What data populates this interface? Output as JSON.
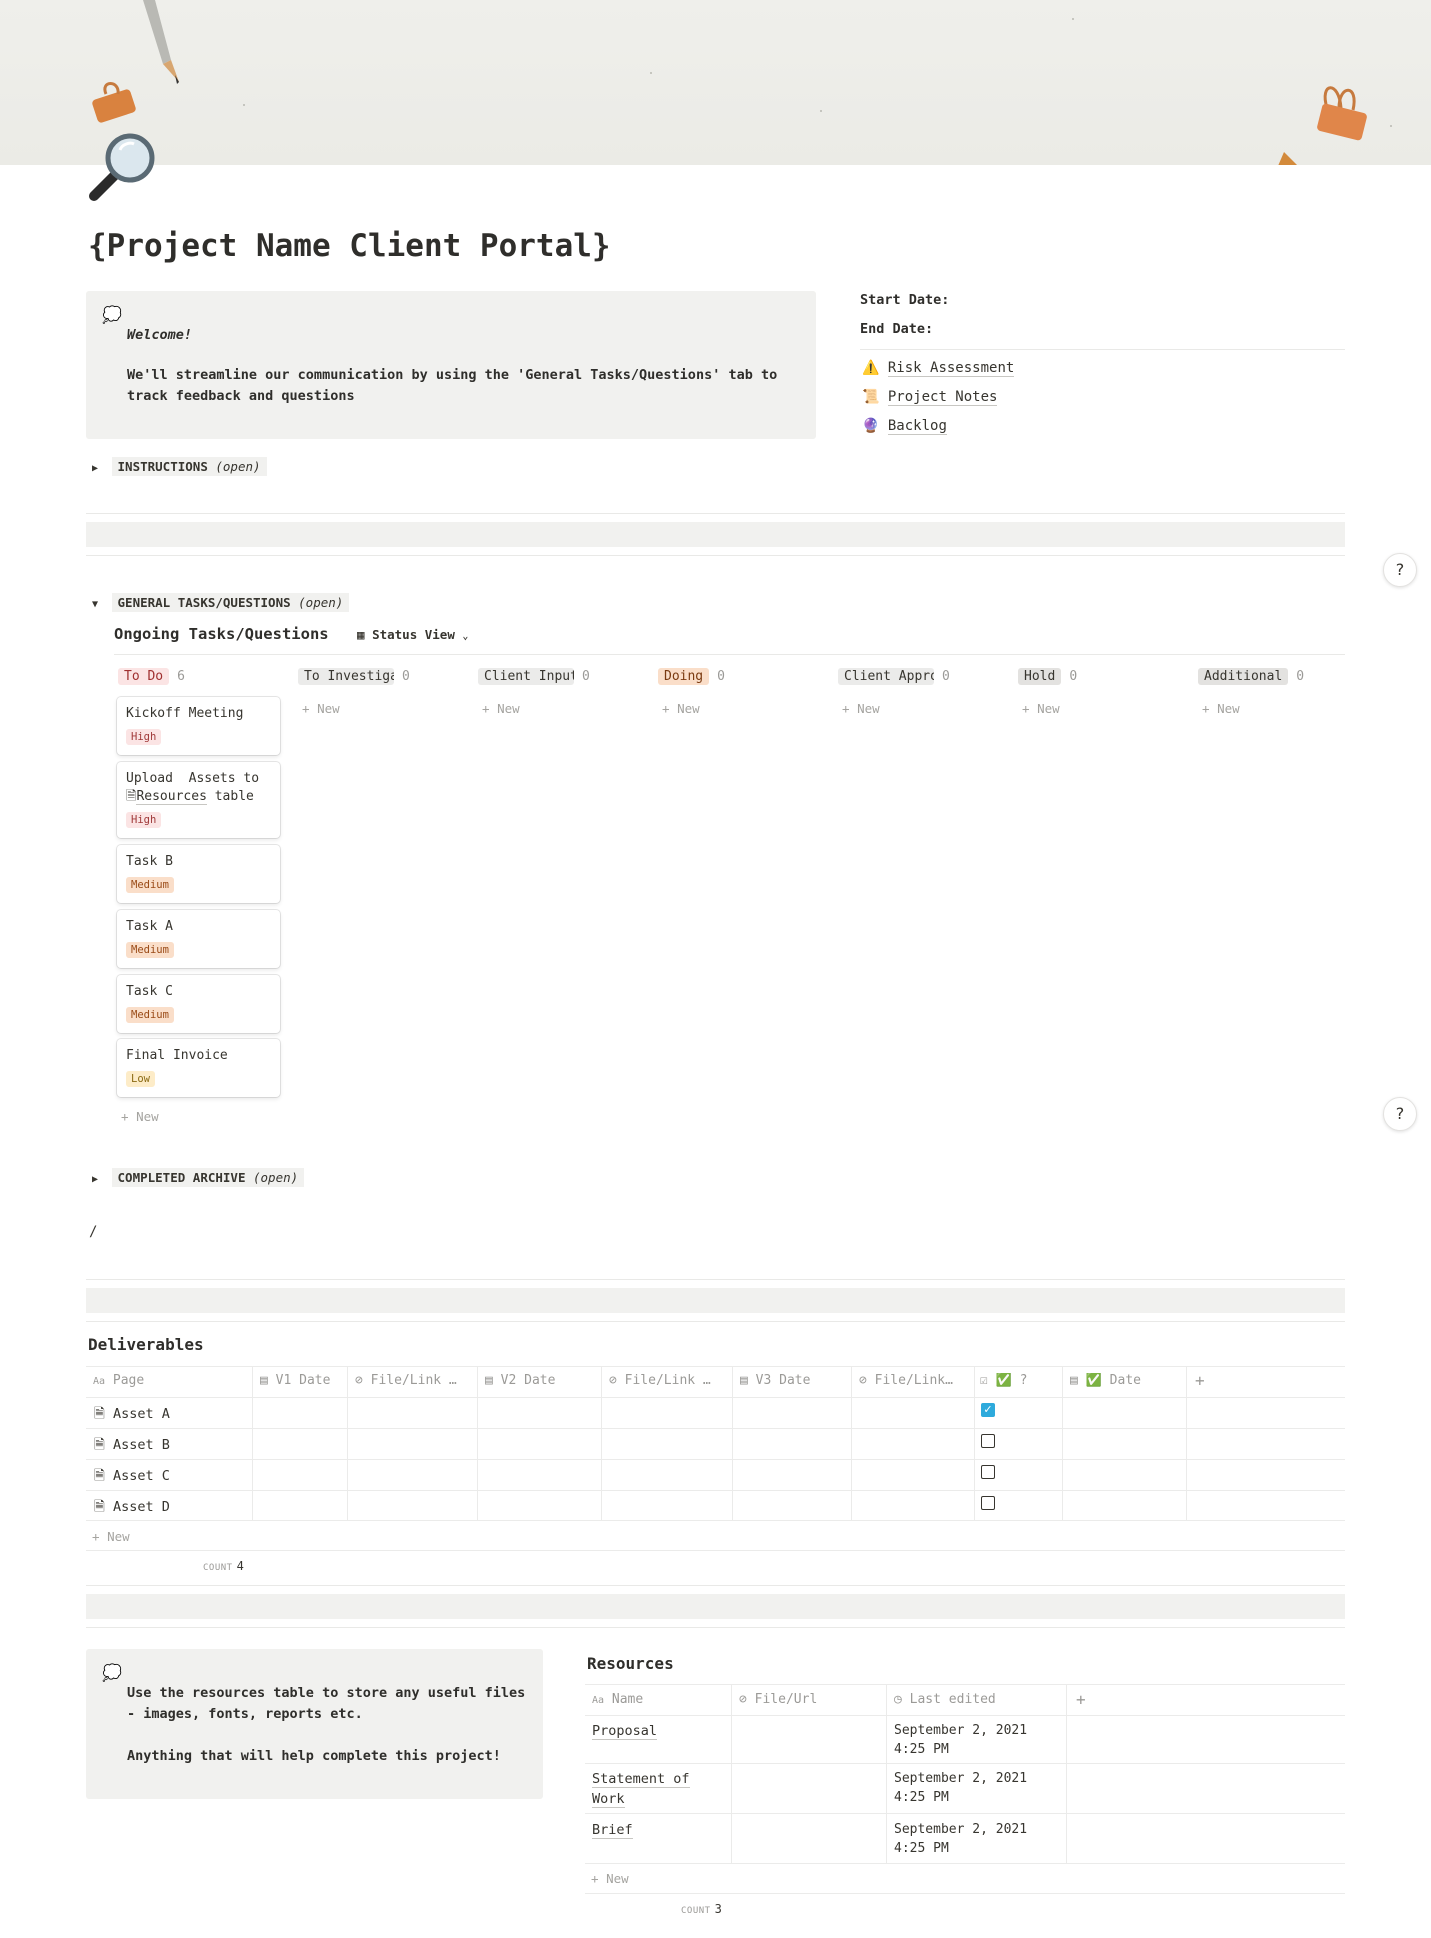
{
  "page": {
    "title": "{Project Name Client Portal}",
    "icon": "magnifying-glass-icon"
  },
  "welcome_callout": {
    "icon": "thought-bubble-icon",
    "line1": "Welcome!",
    "line2": "We'll streamline our communication by using the 'General Tasks/Questions' tab to track feedback and questions"
  },
  "properties": {
    "start_date_label": "Start Date:",
    "end_date_label": "End Date:"
  },
  "page_links": [
    {
      "icon": "⚠️",
      "label": "Risk Assessment"
    },
    {
      "icon": "📜",
      "label": "Project Notes"
    },
    {
      "icon": "🔮",
      "label": "Backlog"
    }
  ],
  "toggles": {
    "instructions": {
      "label": "INSTRUCTIONS",
      "hint": "(open)"
    },
    "general": {
      "label": "GENERAL TASKS/QUESTIONS",
      "hint": "(open)"
    },
    "archive": {
      "label": "COMPLETED ARCHIVE",
      "hint": "(open)"
    }
  },
  "board": {
    "title": "Ongoing Tasks/Questions",
    "view_label": "Status View",
    "new_label": "New",
    "columns": [
      {
        "label": "To Do",
        "count": "6",
        "bg": "#fbe4e4",
        "color": "#9f2f2f"
      },
      {
        "label": "To Investigate",
        "count": "0",
        "bg": "#ebebea",
        "color": "#37352f"
      },
      {
        "label": "Client Input",
        "count": "0",
        "bg": "#ebebea",
        "color": "#37352f"
      },
      {
        "label": "Doing",
        "count": "0",
        "bg": "#fadec9",
        "color": "#7a3a10"
      },
      {
        "label": "Client Approval",
        "count": "0",
        "bg": "#ebebea",
        "color": "#37352f"
      },
      {
        "label": "Hold",
        "count": "0",
        "bg": "#e3e2e0",
        "color": "#37352f"
      },
      {
        "label": "Additional",
        "count": "0",
        "bg": "#e3e2e0",
        "color": "#37352f"
      }
    ],
    "cards": [
      {
        "title": "Kickoff Meeting",
        "priority": "High"
      },
      {
        "title": "Upload  Assets to Resources table",
        "priority": "High"
      },
      {
        "title": "Task B",
        "priority": "Medium"
      },
      {
        "title": "Task A",
        "priority": "Medium"
      },
      {
        "title": "Task C",
        "priority": "Medium"
      },
      {
        "title": "Final Invoice",
        "priority": "Low"
      }
    ]
  },
  "slash": "/",
  "deliverables": {
    "title": "Deliverables",
    "headers": [
      "Page",
      "V1 Date",
      "File/Link …",
      "V2 Date",
      "File/Link …",
      "V3 Date",
      "File/Link…",
      "✅ ?",
      "✅ Date"
    ],
    "rows": [
      {
        "name": "Asset A",
        "checked": true
      },
      {
        "name": "Asset B",
        "checked": false
      },
      {
        "name": "Asset C",
        "checked": false
      },
      {
        "name": "Asset D",
        "checked": false
      }
    ],
    "new_label": "New",
    "count_label": "COUNT",
    "count_value": "4"
  },
  "resources_callout": {
    "icon": "thought-bubble-icon",
    "text": "Use the resources table to store any useful files - images, fonts, reports etc.\n\nAnything that will help complete this project!"
  },
  "resources": {
    "title": "Resources",
    "headers": [
      "Name",
      "File/Url",
      "Last edited"
    ],
    "rows": [
      {
        "name": "Proposal",
        "edited": "September 2, 2021 4:25 PM"
      },
      {
        "name": "Statement of Work",
        "edited": "September 2, 2021 4:25 PM"
      },
      {
        "name": "Brief",
        "edited": "September 2, 2021 4:25 PM"
      }
    ],
    "new_label": "New",
    "count_label": "COUNT",
    "count_value": "3"
  },
  "colors": {
    "accent_checkbox": "#2eaadc",
    "callout_bg": "#f1f1ef"
  }
}
